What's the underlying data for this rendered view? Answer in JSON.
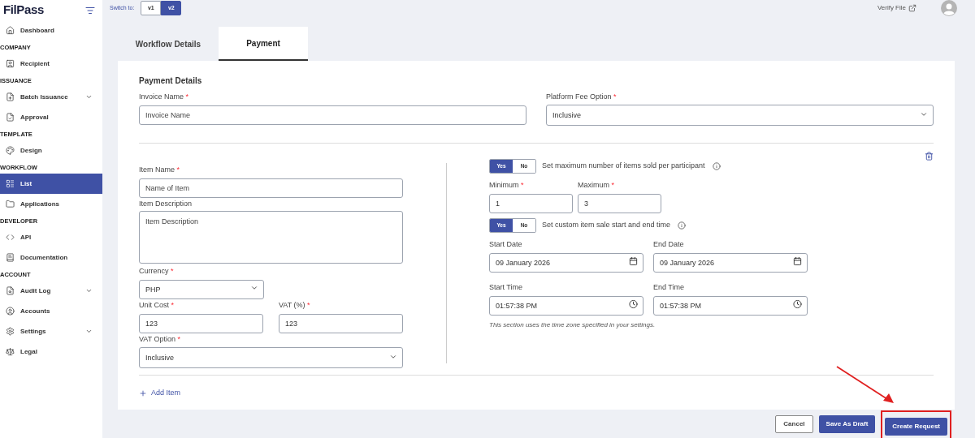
{
  "brand": "FilPass",
  "sidebar": {
    "sections": [
      {
        "items": [
          {
            "label": "Dashboard",
            "expandable": false,
            "selected": false
          }
        ]
      },
      {
        "heading": "COMPANY",
        "items": [
          {
            "label": "Recipient",
            "expandable": false,
            "selected": false
          }
        ]
      },
      {
        "heading": "ISSUANCE",
        "items": [
          {
            "label": "Batch Issuance",
            "expandable": true,
            "selected": false
          },
          {
            "label": "Approval",
            "expandable": false,
            "selected": false
          }
        ]
      },
      {
        "heading": "TEMPLATE",
        "items": [
          {
            "label": "Design",
            "expandable": false,
            "selected": false
          }
        ]
      },
      {
        "heading": "WORKFLOW",
        "items": [
          {
            "label": "List",
            "expandable": false,
            "selected": true
          },
          {
            "label": "Applications",
            "expandable": false,
            "selected": false
          }
        ]
      },
      {
        "heading": "DEVELOPER",
        "items": [
          {
            "label": "API",
            "expandable": false,
            "selected": false
          },
          {
            "label": "Documentation",
            "expandable": false,
            "selected": false
          }
        ]
      },
      {
        "heading": "ACCOUNT",
        "items": [
          {
            "label": "Audit Log",
            "expandable": true,
            "selected": false
          },
          {
            "label": "Accounts",
            "expandable": false,
            "selected": false
          },
          {
            "label": "Settings",
            "expandable": true,
            "selected": false
          },
          {
            "label": "Legal",
            "expandable": false,
            "selected": false
          }
        ]
      }
    ]
  },
  "switcher": {
    "label": "Switch to:",
    "options": [
      {
        "label": "v1",
        "selected": false
      },
      {
        "label": "v2",
        "selected": true
      }
    ]
  },
  "verify_file": "Verify File",
  "tabs": [
    {
      "label": "Workflow Details",
      "selected": false
    },
    {
      "label": "Payment",
      "selected": true
    }
  ],
  "payment_details": {
    "title": "Payment Details",
    "invoice_name": {
      "label": "Invoice Name",
      "required_mark": "*",
      "placeholder": "Invoice Name"
    },
    "platform_fee_option": {
      "label": "Platform Fee Option",
      "required_mark": "*",
      "value": "Inclusive"
    }
  },
  "item": {
    "item_name": {
      "label": "Item Name",
      "required_mark": "*",
      "placeholder": "Name of Item"
    },
    "item_description": {
      "label": "Item Description",
      "placeholder": "Item Description"
    },
    "currency": {
      "label": "Currency",
      "required_mark": "*",
      "value": "PHP"
    },
    "unit_cost": {
      "label": "Unit Cost",
      "required_mark": "*",
      "value": "123"
    },
    "vat": {
      "label": "VAT (%)",
      "required_mark": "*",
      "value": "123"
    },
    "vat_option": {
      "label": "VAT Option",
      "required_mark": "*",
      "value": "Inclusive"
    },
    "max_items_toggle": {
      "text": "Set maximum number of items sold per participant",
      "options": [
        {
          "label": "Yes",
          "selected": true
        },
        {
          "label": "No",
          "selected": false
        }
      ]
    },
    "minimum": {
      "label": "Minimum",
      "required_mark": "*",
      "value": "1"
    },
    "maximum": {
      "label": "Maximum",
      "required_mark": "*",
      "value": "3"
    },
    "custom_time_toggle": {
      "text": "Set custom item sale start and end time",
      "options": [
        {
          "label": "Yes",
          "selected": true
        },
        {
          "label": "No",
          "selected": false
        }
      ]
    },
    "start_date": {
      "label": "Start Date",
      "value": "09 January 2026"
    },
    "end_date": {
      "label": "End Date",
      "value": "09 January 2026"
    },
    "start_time": {
      "label": "Start Time",
      "value": "01:57:38 PM"
    },
    "end_time": {
      "label": "End Time",
      "value": "01:57:38 PM"
    },
    "timezone_note": "This section uses the time zone specified in your settings."
  },
  "add_item": "Add Item",
  "footer_buttons": [
    {
      "label": "Cancel",
      "kind": "outline",
      "highlighted": false
    },
    {
      "label": "Save As Draft",
      "kind": "primary",
      "highlighted": false
    },
    {
      "label": "Create Request",
      "kind": "primary",
      "highlighted": true
    }
  ]
}
